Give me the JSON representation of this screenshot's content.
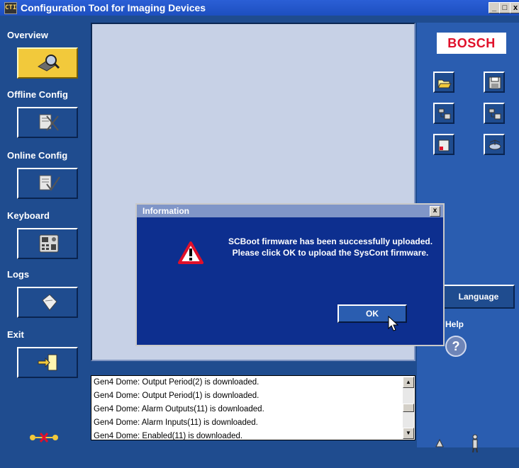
{
  "window": {
    "title": "Configuration Tool for Imaging Devices",
    "app_icon_text": "CTI",
    "controls": [
      "_",
      "□",
      "x"
    ]
  },
  "sidebar": {
    "items": [
      {
        "label": "Overview",
        "icon": "magnifier-icon",
        "active": true
      },
      {
        "label": "Offline Config",
        "icon": "offline-config-icon",
        "active": false
      },
      {
        "label": "Online Config",
        "icon": "online-config-icon",
        "active": false
      },
      {
        "label": "Keyboard",
        "icon": "keyboard-icon",
        "active": false
      },
      {
        "label": "Logs",
        "icon": "logs-icon",
        "active": false
      },
      {
        "label": "Exit",
        "icon": "exit-icon",
        "active": false
      }
    ],
    "status_icon": "connection-status-icon"
  },
  "right_panel": {
    "brand": "BOSCH",
    "tools": [
      "open-folder-icon",
      "save-icon",
      "upload-icon",
      "download-icon",
      "folder-icon",
      "network-icon"
    ],
    "language_label": "Language",
    "help_label": "Help",
    "help_icon_text": "?"
  },
  "log": {
    "lines": [
      "Gen4 Dome: Output Period(2) is downloaded.",
      "Gen4 Dome: Output Period(1) is downloaded.",
      "Gen4 Dome: Alarm Outputs(11) is downloaded.",
      "Gen4 Dome: Alarm Inputs(11) is downloaded.",
      "Gen4 Dome: Enabled(11) is downloaded."
    ]
  },
  "dialog": {
    "title": "Information",
    "close_label": "x",
    "message": "SCBoot firmware has been successfully uploaded.  Please click OK to upload the SysCont firmware.",
    "ok_label": "OK"
  },
  "colors": {
    "background": "#1f4c8f",
    "active_button": "#f2c93b",
    "brand_red": "#e0102a",
    "dialog_bg": "#0d2f8f"
  }
}
